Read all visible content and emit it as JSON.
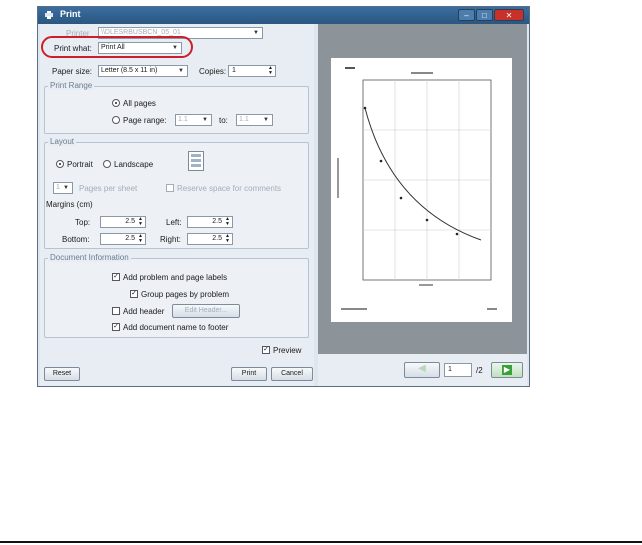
{
  "window": {
    "title": "Print",
    "controls": {
      "minimize": "–",
      "maximize": "□",
      "close": "✕"
    }
  },
  "printer": {
    "label": "Printer",
    "value": "\\\\DLESRBUSBCN_05_01"
  },
  "print_what": {
    "label": "Print what:",
    "value": "Print All"
  },
  "paper_size": {
    "label": "Paper size:",
    "value": "Letter (8.5 x 11 in)"
  },
  "copies": {
    "label": "Copies:",
    "value": "1"
  },
  "print_range": {
    "title": "Print Range",
    "all_pages": "All pages",
    "page_range": "Page range:",
    "from": "1.1",
    "to_label": "to:",
    "to": "1.1",
    "selected": "all_pages"
  },
  "layout": {
    "title": "Layout",
    "portrait": "Portrait",
    "landscape": "Landscape",
    "selected": "portrait",
    "pages_per_sheet_value": "1",
    "pages_per_sheet_label": "Pages per sheet",
    "reserve_space": "Reserve space for comments",
    "margins_label": "Margins (cm)",
    "top_label": "Top:",
    "top": "2.5",
    "left_label": "Left:",
    "left": "2.5",
    "bottom_label": "Bottom:",
    "bottom": "2.5",
    "right_label": "Right:",
    "right": "2.5"
  },
  "document_info": {
    "title": "Document Information",
    "add_problem_labels": "Add problem and page labels",
    "group_pages": "Group pages by problem",
    "add_header": "Add header",
    "edit_header": "Edit Header...",
    "add_doc_name": "Add document name to footer",
    "checked": {
      "add_problem_labels": true,
      "group_pages": true,
      "add_header": false,
      "add_doc_name": true
    }
  },
  "preview": {
    "label": "Preview",
    "checked": true
  },
  "buttons": {
    "reset": "Reset",
    "print": "Print",
    "cancel": "Cancel"
  },
  "pager": {
    "current": "1",
    "total": "/2"
  },
  "colors": {
    "highlight": "#cc1f2b",
    "titlebar": "#2b5680",
    "close": "#c8312a",
    "next": "#3aa13a"
  }
}
